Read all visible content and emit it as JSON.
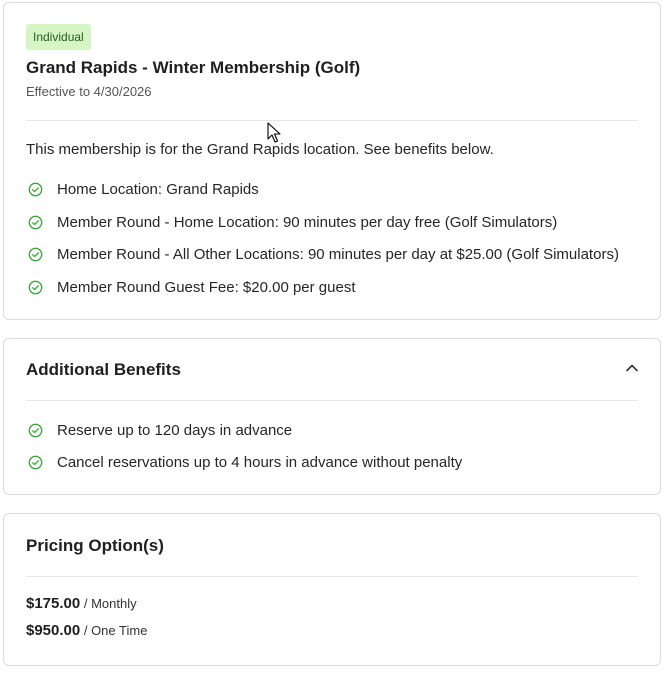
{
  "membership": {
    "badge": "Individual",
    "title": "Grand Rapids - Winter Membership (Golf)",
    "effective": "Effective to 4/30/2026",
    "description": "This membership is for the Grand Rapids location. See benefits below.",
    "benefits": [
      "Home Location: Grand Rapids",
      "Member Round - Home Location: 90 minutes per day free (Golf Simulators)",
      "Member Round - All Other Locations: 90 minutes per day at $25.00 (Golf Simulators)",
      "Member Round Guest Fee: $20.00 per guest"
    ]
  },
  "additional": {
    "title": "Additional Benefits",
    "expanded": true,
    "benefits": [
      "Reserve up to 120 days in advance",
      "Cancel reservations up to 4 hours in advance without penalty"
    ]
  },
  "pricing": {
    "title": "Pricing Option(s)",
    "options": [
      {
        "amount": "$175.00",
        "period": " / Monthly"
      },
      {
        "amount": "$950.00",
        "period": " / One Time"
      }
    ]
  },
  "colors": {
    "badge_bg": "#d6f5c5",
    "check": "#3aa33a"
  },
  "icons": {
    "check": "check-circle-icon",
    "collapse": "chevron-up-icon",
    "pointer": "mouse-cursor-icon"
  }
}
